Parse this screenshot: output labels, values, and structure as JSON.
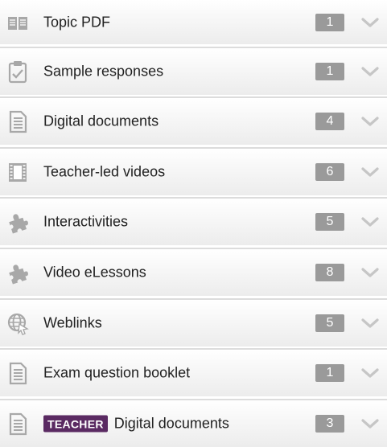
{
  "resources": [
    {
      "icon": "book-icon",
      "label": "Topic PDF",
      "count": "1",
      "tag": ""
    },
    {
      "icon": "clipboard-check-icon",
      "label": "Sample responses",
      "count": "1",
      "tag": ""
    },
    {
      "icon": "document-icon",
      "label": "Digital documents",
      "count": "4",
      "tag": ""
    },
    {
      "icon": "film-icon",
      "label": "Teacher-led videos",
      "count": "6",
      "tag": ""
    },
    {
      "icon": "puzzle-icon",
      "label": "Interactivities",
      "count": "5",
      "tag": ""
    },
    {
      "icon": "puzzle-icon",
      "label": "Video eLessons",
      "count": "8",
      "tag": ""
    },
    {
      "icon": "globe-cursor-icon",
      "label": "Weblinks",
      "count": "5",
      "tag": ""
    },
    {
      "icon": "document-icon",
      "label": "Exam question booklet",
      "count": "1",
      "tag": ""
    },
    {
      "icon": "document-icon",
      "label": "Digital documents",
      "count": "3",
      "tag": "TEACHER"
    }
  ],
  "colors": {
    "icon": "#a8a8a8",
    "badge_bg": "#9a9a9a",
    "teacher_bg": "#5a2a62",
    "chevron": "#c6c6c6"
  }
}
